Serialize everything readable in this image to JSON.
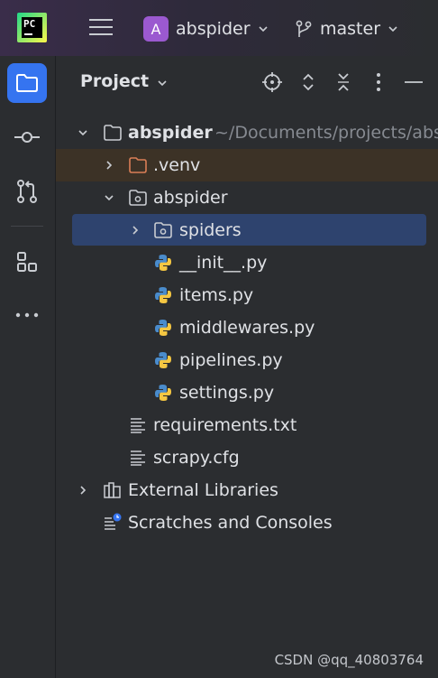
{
  "titlebar": {
    "project_badge": "A",
    "project_name": "abspider",
    "branch": "master"
  },
  "toolstrip": {
    "items": [
      "project",
      "commit",
      "pull-requests",
      "structure",
      "more"
    ]
  },
  "panel": {
    "title": "Project"
  },
  "tree": {
    "root": {
      "name": "abspider",
      "path": "~/Documents/projects/absp"
    },
    "venv": ".venv",
    "pkg": "abspider",
    "spiders": "spiders",
    "init": "__init__.py",
    "items": "items.py",
    "middlewares": "middlewares.py",
    "pipelines": "pipelines.py",
    "settings": "settings.py",
    "requirements": "requirements.txt",
    "scrapy_cfg": "scrapy.cfg",
    "external": "External Libraries",
    "scratches": "Scratches and Consoles"
  },
  "watermark": "CSDN @qq_40803764",
  "colors": {
    "accent": "#3574f0",
    "selection": "#2e436e",
    "excluded_bg": "#3c3226",
    "venv_folder": "#d97e56",
    "badge": "#9b59d0"
  }
}
